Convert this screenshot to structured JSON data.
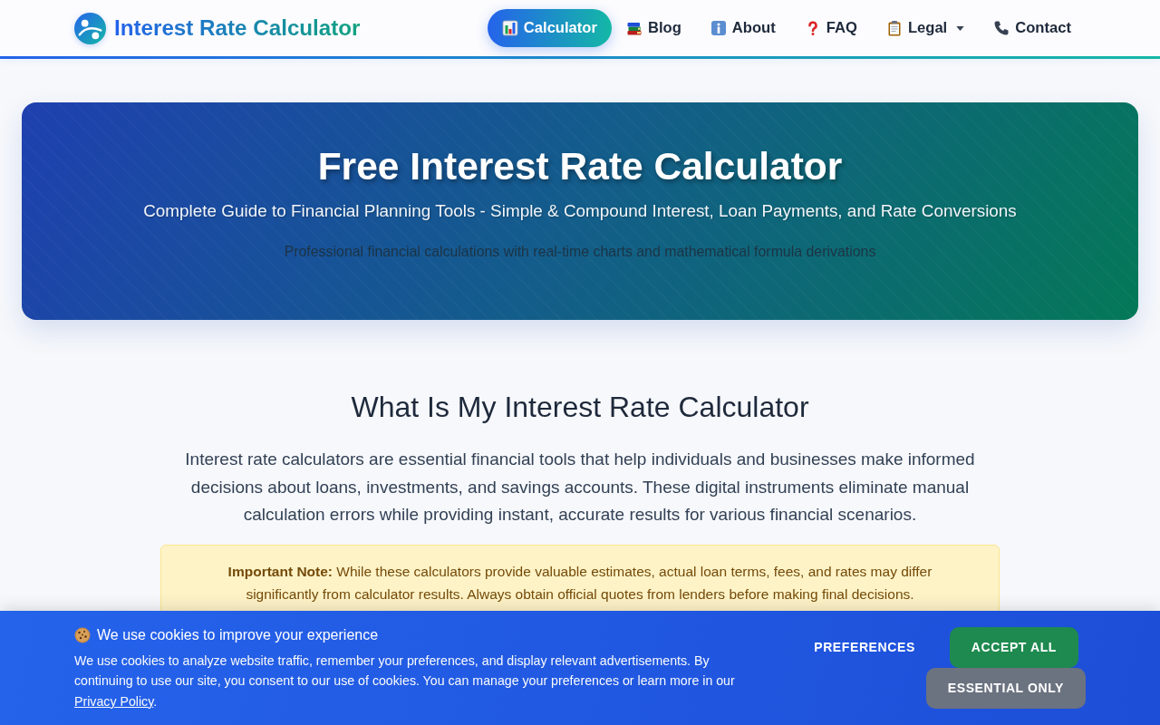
{
  "brand": {
    "name": "Interest Rate Calculator"
  },
  "nav": {
    "items": [
      {
        "label": "Calculator",
        "selected": true,
        "dropdown": false
      },
      {
        "label": "Blog",
        "selected": false,
        "dropdown": false
      },
      {
        "label": "About",
        "selected": false,
        "dropdown": false
      },
      {
        "label": "FAQ",
        "selected": false,
        "dropdown": false
      },
      {
        "label": "Legal",
        "selected": false,
        "dropdown": true
      },
      {
        "label": "Contact",
        "selected": false,
        "dropdown": false
      }
    ]
  },
  "hero": {
    "title": "Free Interest Rate Calculator",
    "subtitle": "Complete Guide to Financial Planning Tools - Simple & Compound Interest, Loan Payments, and Rate Conversions",
    "tagline": "Professional financial calculations with real-time charts and mathematical formula derivations"
  },
  "intro": {
    "heading": "What Is My Interest Rate Calculator",
    "paragraph": "Interest rate calculators are essential financial tools that help individuals and businesses make informed decisions about loans, investments, and savings accounts. These digital instruments eliminate manual calculation errors while providing instant, accurate results for various financial scenarios.",
    "note": "**Important Note:** While these calculators provide valuable estimates, actual loan terms, fees, and rates may differ significantly from calculator results. Always obtain official quotes from lenders before making final decisions."
  },
  "cookie_banner": {
    "title": "We use cookies to improve your experience",
    "text": "We use cookies to analyze website traffic, remember your preferences, and display relevant advertisements. By continuing to use our site, you consent to our use of cookies. You can manage your preferences or learn more in our",
    "link": "Privacy Policy",
    "text_after": ".",
    "buttons": [
      {
        "label": "PREFERENCES",
        "kind": "plain"
      },
      {
        "label": "ACCEPT ALL",
        "kind": "primary"
      },
      {
        "label": "ESSENTIAL ONLY",
        "kind": "secondary"
      }
    ]
  }
}
